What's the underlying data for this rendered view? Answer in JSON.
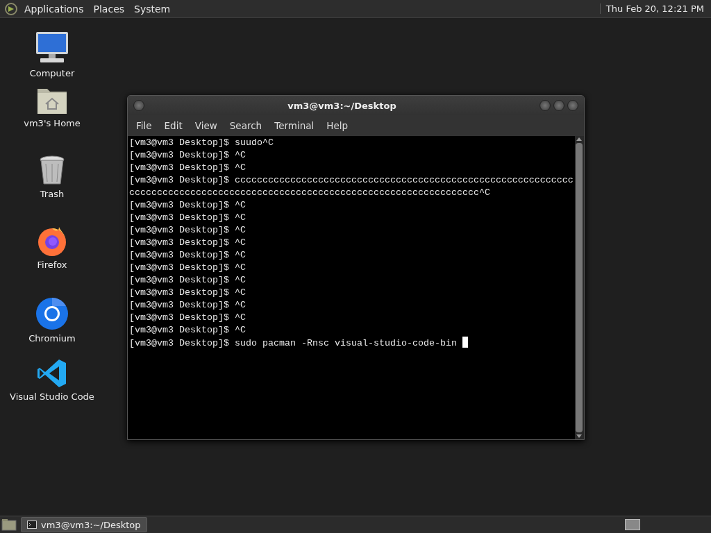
{
  "top_panel": {
    "menus": [
      "Applications",
      "Places",
      "System"
    ],
    "clock": "Thu Feb 20, 12:21 PM"
  },
  "desktop_icons": [
    {
      "label": "Computer",
      "kind": "computer"
    },
    {
      "label": "vm3's Home",
      "kind": "home"
    },
    {
      "label": "Trash",
      "kind": "trash"
    },
    {
      "label": "Firefox",
      "kind": "firefox"
    },
    {
      "label": "Chromium",
      "kind": "chromium"
    },
    {
      "label": "Visual Studio Code",
      "kind": "vscode"
    }
  ],
  "window": {
    "title": "vm3@vm3:~/Desktop",
    "menu": [
      "File",
      "Edit",
      "View",
      "Search",
      "Terminal",
      "Help"
    ],
    "terminal": {
      "cursor": true,
      "lines": [
        "[vm3@vm3 Desktop]$ suudo^C",
        "[vm3@vm3 Desktop]$ ^C",
        "[vm3@vm3 Desktop]$ ^C",
        "[vm3@vm3 Desktop]$ ccccccccccccccccccccccccccccccccccccccccccccccccccccccccccccc",
        "ccccccccccccccccccccccccccccccccccccccccccccccccccccccccccccccc^C",
        "[vm3@vm3 Desktop]$ ^C",
        "[vm3@vm3 Desktop]$ ^C",
        "[vm3@vm3 Desktop]$ ^C",
        "[vm3@vm3 Desktop]$ ^C",
        "[vm3@vm3 Desktop]$ ^C",
        "[vm3@vm3 Desktop]$ ^C",
        "[vm3@vm3 Desktop]$ ^C",
        "[vm3@vm3 Desktop]$ ^C",
        "[vm3@vm3 Desktop]$ ^C",
        "[vm3@vm3 Desktop]$ ^C",
        "[vm3@vm3 Desktop]$ ^C",
        "[vm3@vm3 Desktop]$ sudo pacman -Rnsc visual-studio-code-bin "
      ]
    }
  },
  "taskbar": {
    "tasks": [
      {
        "label": "vm3@vm3:~/Desktop",
        "selected": true
      }
    ]
  }
}
